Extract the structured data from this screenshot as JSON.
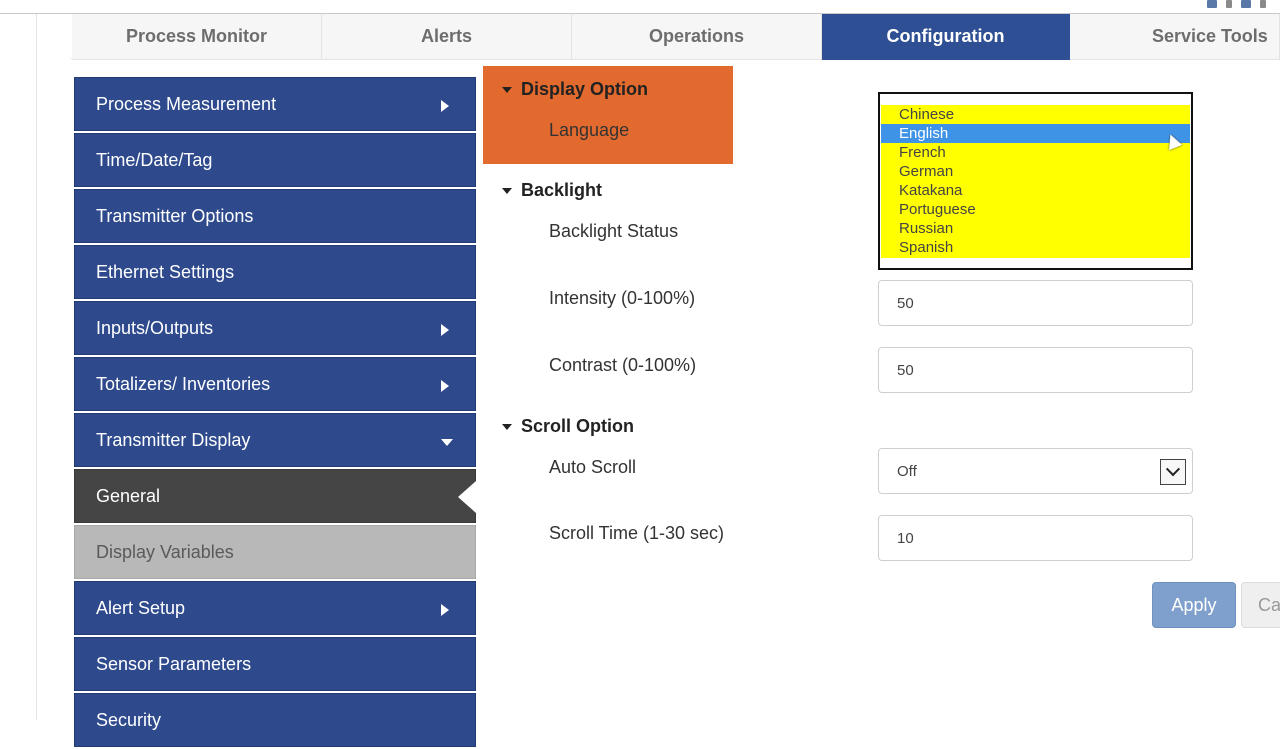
{
  "tabs": [
    {
      "label": "Process Monitor",
      "active": false
    },
    {
      "label": "Alerts",
      "active": false
    },
    {
      "label": "Operations",
      "active": false
    },
    {
      "label": "Configuration",
      "active": true
    },
    {
      "label": "Service Tools",
      "active": false
    }
  ],
  "sidebar": {
    "items": [
      {
        "label": "Process Measurement",
        "chevron": "right"
      },
      {
        "label": "Time/Date/Tag",
        "chevron": ""
      },
      {
        "label": "Transmitter Options",
        "chevron": ""
      },
      {
        "label": "Ethernet Settings",
        "chevron": ""
      },
      {
        "label": "Inputs/Outputs",
        "chevron": "right"
      },
      {
        "label": "Totalizers/ Inventories",
        "chevron": "right"
      },
      {
        "label": "Transmitter Display",
        "chevron": "down"
      },
      {
        "label": "General",
        "state": "active-sub"
      },
      {
        "label": "Display Variables",
        "state": "sub"
      },
      {
        "label": "Alert Setup",
        "chevron": "right"
      },
      {
        "label": "Sensor Parameters",
        "chevron": ""
      },
      {
        "label": "Security",
        "chevron": ""
      }
    ]
  },
  "display_option": {
    "heading": "Display Option",
    "language_label": "Language",
    "language_options": [
      "Chinese",
      "English",
      "French",
      "German",
      "Katakana",
      "Portuguese",
      "Russian",
      "Spanish"
    ],
    "selected_language": "English"
  },
  "backlight": {
    "heading": "Backlight",
    "status_label": "Backlight Status",
    "intensity_label": "Intensity (0-100%)",
    "intensity_value": "50",
    "contrast_label": "Contrast (0-100%)",
    "contrast_value": "50"
  },
  "scroll_option": {
    "heading": "Scroll Option",
    "auto_scroll_label": "Auto Scroll",
    "auto_scroll_value": "Off",
    "scroll_time_label": "Scroll Time (1-30 sec)",
    "scroll_time_value": "10"
  },
  "buttons": {
    "apply": "Apply",
    "cancel": "Ca"
  },
  "colors": {
    "nav_blue": "#2e4a8c",
    "tab_active": "#2e4f93",
    "highlight_orange": "#e36a2e",
    "listbox_yellow": "#ffff00",
    "selection_blue": "#3f93e6"
  }
}
